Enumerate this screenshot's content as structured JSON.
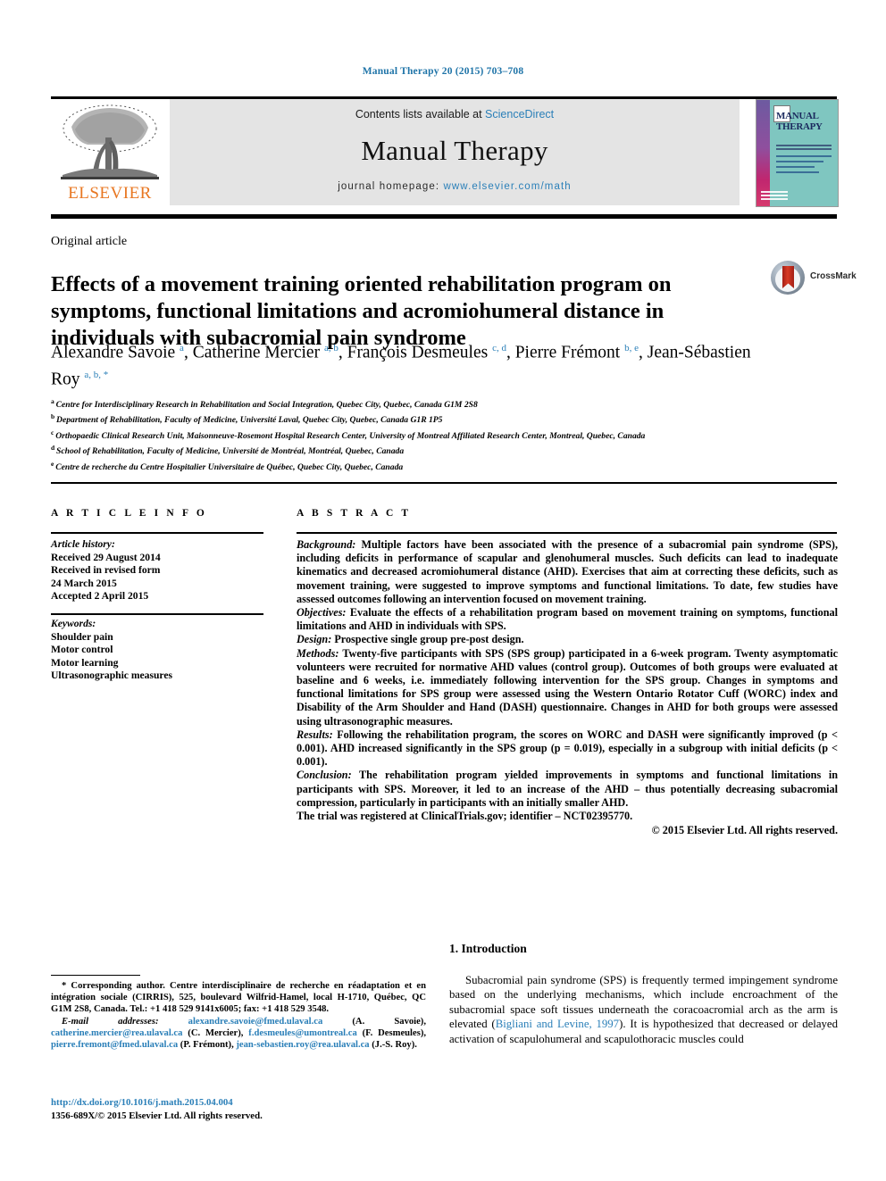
{
  "running_head": "Manual Therapy 20 (2015) 703–708",
  "masthead": {
    "contents_prefix": "Contents lists available at ",
    "sciencedirect": "ScienceDirect",
    "journal_name": "Manual Therapy",
    "homepage_prefix": "journal homepage: ",
    "homepage_url": "www.elsevier.com/math",
    "publisher_logo_text": "ELSEVIER",
    "cover_title_line1": "MANUAL",
    "cover_title_line2": "THERAPY"
  },
  "article": {
    "type": "Original article",
    "title": "Effects of a movement training oriented rehabilitation program on symptoms, functional limitations and acromiohumeral distance in individuals with subacromial pain syndrome",
    "crossmark_label": "CrossMark"
  },
  "authors": {
    "list": [
      {
        "name": "Alexandre Savoie",
        "sup": "a",
        "sep": ", "
      },
      {
        "name": "Catherine Mercier",
        "sup": "a, b",
        "sep": ", "
      },
      {
        "name": "François Desmeules",
        "sup": "c, d",
        "sep": ", "
      },
      {
        "name": "Pierre Frémont",
        "sup": "b, e",
        "sep": ", "
      },
      {
        "name": "Jean-Sébastien Roy",
        "sup": "a, b, *",
        "sep": ""
      }
    ]
  },
  "affiliations": [
    {
      "marker": "a",
      "text": "Centre for Interdisciplinary Research in Rehabilitation and Social Integration, Quebec City, Quebec, Canada G1M 2S8"
    },
    {
      "marker": "b",
      "text": "Department of Rehabilitation, Faculty of Medicine, Université Laval, Quebec City, Quebec, Canada G1R 1P5"
    },
    {
      "marker": "c",
      "text": "Orthopaedic Clinical Research Unit, Maisonneuve-Rosemont Hospital Research Center, University of Montreal Affiliated Research Center, Montreal, Quebec, Canada"
    },
    {
      "marker": "d",
      "text": "School of Rehabilitation, Faculty of Medicine, Université de Montréal, Montréal, Quebec, Canada"
    },
    {
      "marker": "e",
      "text": "Centre de recherche du Centre Hospitalier Universitaire de Québec, Quebec City, Quebec, Canada"
    }
  ],
  "article_info": {
    "header": "A R T I C L E   I N F O",
    "history_label": "Article history:",
    "history": [
      "Received 29 August 2014",
      "Received in revised form",
      "24 March 2015",
      "Accepted 2 April 2015"
    ],
    "keywords_label": "Keywords:",
    "keywords": [
      "Shoulder pain",
      "Motor control",
      "Motor learning",
      "Ultrasonographic measures"
    ]
  },
  "abstract": {
    "header": "A B S T R A C T",
    "sections": [
      {
        "label": "Background:",
        "text": " Multiple factors have been associated with the presence of a subacromial pain syndrome (SPS), including deficits in performance of scapular and glenohumeral muscles. Such deficits can lead to inadequate kinematics and decreased acromiohumeral distance (AHD). Exercises that aim at correcting these deficits, such as movement training, were suggested to improve symptoms and functional limitations. To date, few studies have assessed outcomes following an intervention focused on movement training."
      },
      {
        "label": "Objectives:",
        "text": " Evaluate the effects of a rehabilitation program based on movement training on symptoms, functional limitations and AHD in individuals with SPS."
      },
      {
        "label": "Design:",
        "text": " Prospective single group pre-post design."
      },
      {
        "label": "Methods:",
        "text": " Twenty-five participants with SPS (SPS group) participated in a 6-week program. Twenty asymptomatic volunteers were recruited for normative AHD values (control group). Outcomes of both groups were evaluated at baseline and 6 weeks, i.e. immediately following intervention for the SPS group. Changes in symptoms and functional limitations for SPS group were assessed using the Western Ontario Rotator Cuff (WORC) index and Disability of the Arm Shoulder and Hand (DASH) questionnaire. Changes in AHD for both groups were assessed using ultrasonographic measures."
      },
      {
        "label": "Results:",
        "text": " Following the rehabilitation program, the scores on WORC and DASH were significantly improved (p < 0.001). AHD increased significantly in the SPS group (p = 0.019), especially in a subgroup with initial deficits (p < 0.001)."
      },
      {
        "label": "Conclusion:",
        "text": " The rehabilitation program yielded improvements in symptoms and functional limitations in participants with SPS. Moreover, it led to an increase of the AHD – thus potentially decreasing subacromial compression, particularly in participants with an initially smaller AHD."
      },
      {
        "label": "",
        "text": "The trial was registered at ClinicalTrials.gov; identifier – NCT02395770."
      }
    ],
    "copyright": "© 2015 Elsevier Ltd. All rights reserved."
  },
  "footnote": {
    "corresponding": "* Corresponding author. Centre interdisciplinaire de recherche en réadaptation et en intégration sociale (CIRRIS), 525, boulevard Wilfrid-Hamel, local H-1710, Québec, QC G1M 2S8, Canada. Tel.: +1 418 529 9141x6005; fax: +1 418 529 3548.",
    "email_label": "E-mail addresses:",
    "emails": [
      {
        "address": "alexandre.savoie@fmed.ulaval.ca",
        "owner": "(A. Savoie)"
      },
      {
        "address": "catherine.mercier@rea.ulaval.ca",
        "owner": "(C. Mercier)"
      },
      {
        "address": "f.desmeules@umontreal.ca",
        "owner": "(F. Desmeules)"
      },
      {
        "address": "pierre.fremont@fmed.ulaval.ca",
        "owner": "(P. Frémont)"
      },
      {
        "address": "jean-sebastien.roy@rea.ulaval.ca",
        "owner": "(J.-S. Roy)"
      }
    ],
    "doi": "http://dx.doi.org/10.1016/j.math.2015.04.004",
    "issn_line": "1356-689X/© 2015 Elsevier Ltd. All rights reserved."
  },
  "introduction": {
    "heading": "1. Introduction",
    "paragraph_pre": "Subacromial pain syndrome (SPS) is frequently termed impingement syndrome based on the underlying mechanisms, which include encroachment of the subacromial space soft tissues underneath the coracoacromial arch as the arm is elevated (",
    "citation": "Bigliani and Levine, 1997",
    "paragraph_post": "). It is hypothesized that decreased or delayed activation of scapulohumeral and scapulothoracic muscles could"
  },
  "colors": {
    "link": "#2a7fb8",
    "elsevier_orange": "#e87722",
    "cover_teal": "#7fc6c0",
    "crossmark_red": "#c0392b"
  }
}
